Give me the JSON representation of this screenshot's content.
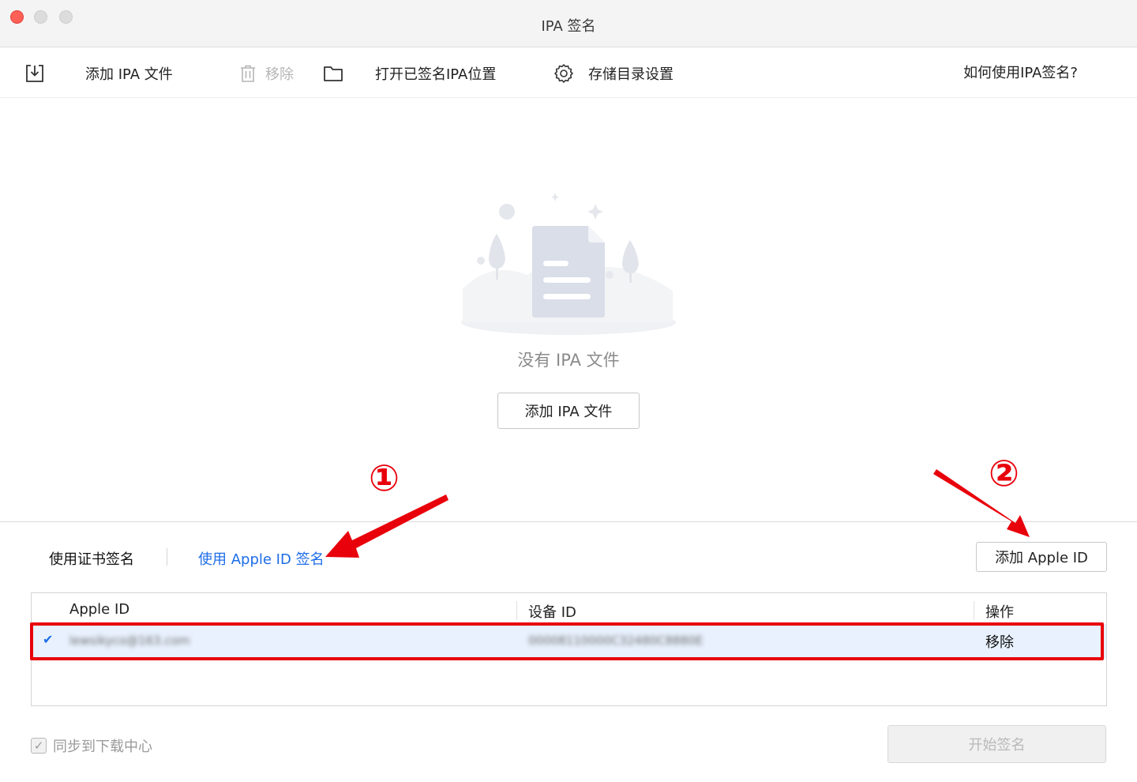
{
  "window": {
    "title": "IPA 签名"
  },
  "toolbar": {
    "add_ipa": "添加 IPA 文件",
    "remove": "移除",
    "open_signed": "打开已签名IPA位置",
    "storage_settings": "存储目录设置",
    "help": "如何使用IPA签名?"
  },
  "empty": {
    "message": "没有 IPA 文件",
    "add_button": "添加 IPA 文件"
  },
  "sign": {
    "tab_cert": "使用证书签名",
    "tab_appleid": "使用 Apple ID 签名",
    "add_appleid": "添加 Apple ID"
  },
  "table": {
    "headers": [
      "Apple ID",
      "设备 ID",
      "操作"
    ],
    "rows": [
      {
        "apple_id": "lewsikyco@163.com",
        "device_id": "00008110000C32480C8880E",
        "action": "移除",
        "checked": true
      }
    ]
  },
  "footer": {
    "sync_label": "同步到下载中心",
    "start_button": "开始签名"
  },
  "annotations": {
    "step1": "①",
    "step2": "②"
  },
  "colors": {
    "accent": "#1d6de8",
    "annotation": "#e8000b",
    "selected_row": "#e8f1fd"
  }
}
